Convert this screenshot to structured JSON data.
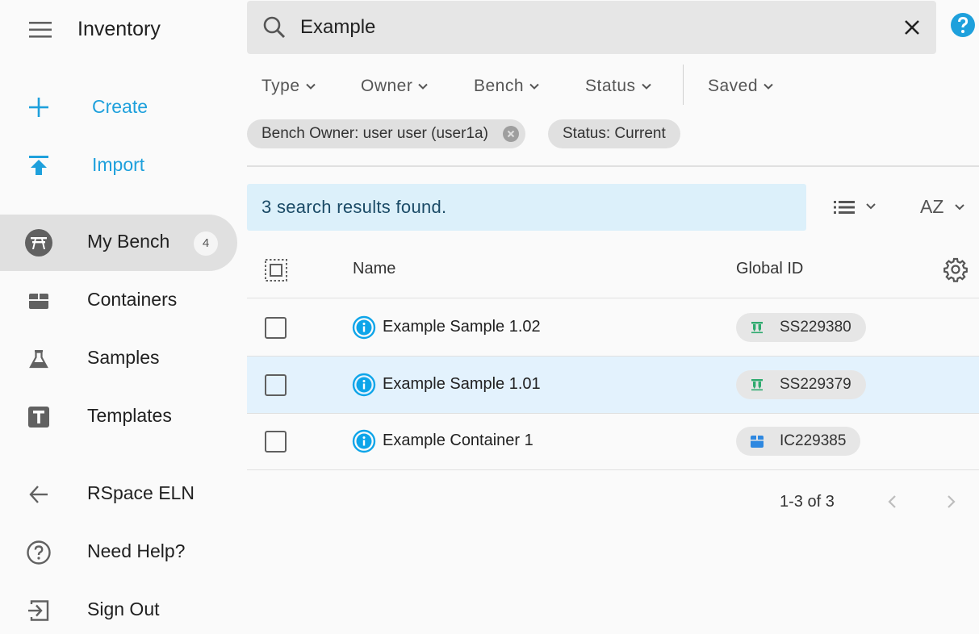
{
  "app": {
    "title": "Inventory"
  },
  "sidebar": {
    "actions": [
      {
        "label": "Create",
        "icon": "plus-icon"
      },
      {
        "label": "Import",
        "icon": "upload-icon"
      }
    ],
    "nav": [
      {
        "label": "My Bench",
        "icon": "bench-icon",
        "badge": "4",
        "active": true
      },
      {
        "label": "Containers",
        "icon": "container-icon"
      },
      {
        "label": "Samples",
        "icon": "flask-icon"
      },
      {
        "label": "Templates",
        "icon": "template-icon"
      }
    ],
    "footer": [
      {
        "label": "RSpace ELN",
        "icon": "arrow-left-icon"
      },
      {
        "label": "Need Help?",
        "icon": "help-circle-icon"
      },
      {
        "label": "Sign Out",
        "icon": "sign-out-icon"
      }
    ]
  },
  "search": {
    "value": "Example",
    "placeholder": ""
  },
  "filters": [
    {
      "label": "Type"
    },
    {
      "label": "Owner"
    },
    {
      "label": "Bench"
    },
    {
      "label": "Status"
    },
    {
      "label": "Saved"
    }
  ],
  "chips": [
    {
      "label": "Bench Owner: user user (user1a)",
      "removable": true
    },
    {
      "label": "Status: Current",
      "removable": false
    }
  ],
  "results": {
    "banner": "3 search results found."
  },
  "sort": {
    "label": "AZ"
  },
  "table": {
    "columns": {
      "name": "Name",
      "global_id": "Global ID"
    },
    "rows": [
      {
        "name": "Example Sample 1.02",
        "global_id": "SS229380",
        "type": "sample",
        "highlighted": false
      },
      {
        "name": "Example Sample 1.01",
        "global_id": "SS229379",
        "type": "sample",
        "highlighted": true
      },
      {
        "name": "Example Container 1",
        "global_id": "IC229385",
        "type": "container",
        "highlighted": false
      }
    ]
  },
  "pagination": {
    "range": "1-3 of 3"
  },
  "colors": {
    "accent": "#1ea0dc",
    "info": "#0ea5e9",
    "sample_icon": "#2eaa6e",
    "container_icon": "#2e88e0",
    "highlight_row": "#e3f2fd",
    "banner_bg": "#dcf0fa"
  }
}
